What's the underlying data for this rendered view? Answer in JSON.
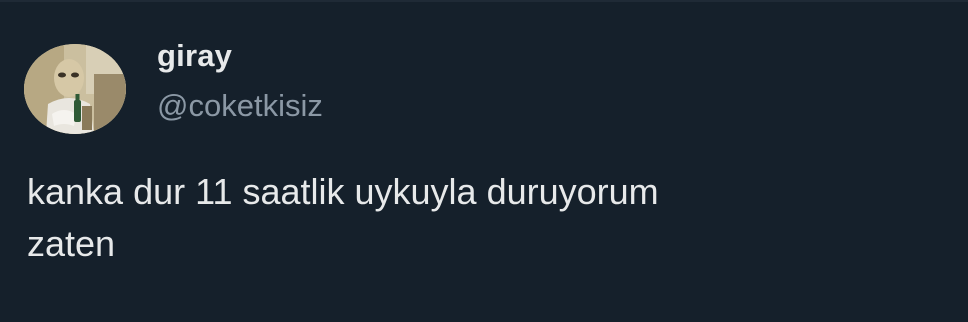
{
  "colors": {
    "background": "#15202b",
    "primary_text": "#e7e9ea",
    "secondary_text": "#8b98a5"
  },
  "author": {
    "display_name": "giray",
    "handle": "@coketkisiz",
    "avatar_icon": "profile-photo"
  },
  "tweet": {
    "text": "kanka dur 11 saatlik uykuyla duruyorum\nzaten"
  }
}
